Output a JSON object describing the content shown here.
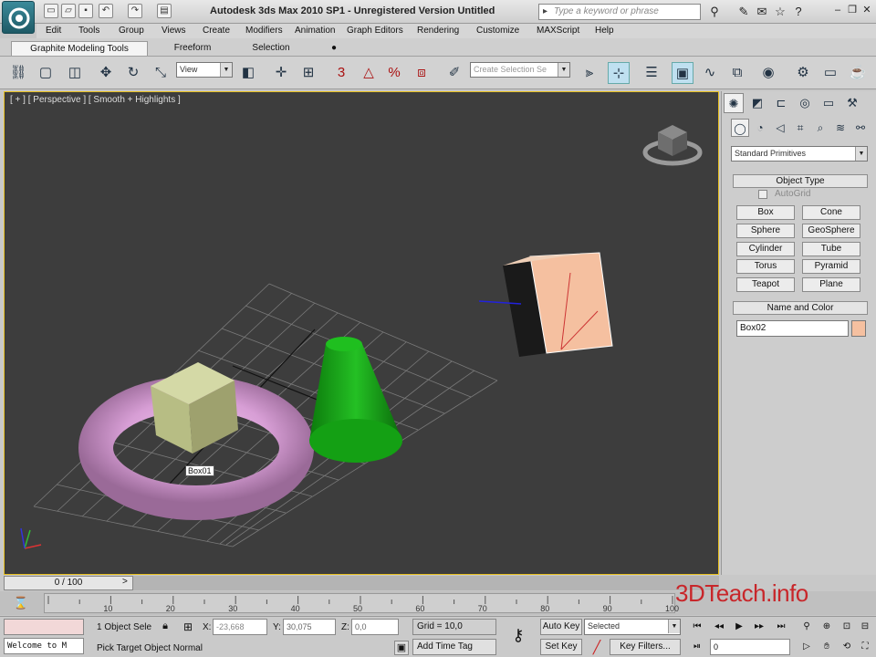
{
  "title_bar": {
    "title": "Autodesk 3ds Max  2010 SP1   -  Unregistered Version     Untitled",
    "search_placeholder": "Type a keyword or phrase"
  },
  "menu_items": [
    "Edit",
    "Tools",
    "Group",
    "Views",
    "Create",
    "Modifiers",
    "Animation",
    "Graph Editors",
    "Rendering",
    "Customize",
    "MAXScript",
    "Help"
  ],
  "ribbon_tabs": [
    "Graphite Modeling Tools",
    "Freeform",
    "Selection"
  ],
  "toolbar": {
    "ref_coord_dropdown": "View",
    "snap_angle_label": "3",
    "percent_snap_label": "%",
    "named_selection_placeholder": "Create Selection Se"
  },
  "viewport": {
    "label": "[ + ] [ Perspective ] [ Smooth + Highlights ]",
    "object_tooltip": "Box01"
  },
  "command_panel": {
    "category_dropdown": "Standard Primitives",
    "object_type_header": "Object Type",
    "autogrid_label": "AutoGrid",
    "buttons": [
      "Box",
      "Cone",
      "Sphere",
      "GeoSphere",
      "Cylinder",
      "Tube",
      "Torus",
      "Pyramid",
      "Teapot",
      "Plane"
    ],
    "name_color_header": "Name and Color",
    "name_value": "Box02",
    "object_color": "#f5c0a0"
  },
  "time_slider": {
    "position_label": "0 / 100",
    "ticks": [
      "10",
      "20",
      "30",
      "40",
      "50",
      "60",
      "70",
      "80",
      "90",
      "100"
    ]
  },
  "status_bar": {
    "listener_text": "Welcome to M",
    "selection_text": "1 Object Sele",
    "prompt_text": "Pick Target Object Normal",
    "x_label": "X:",
    "x_value": "-23,668",
    "y_label": "Y:",
    "y_value": "30,075",
    "z_label": "Z:",
    "z_value": "0,0",
    "grid_text": "Grid = 10,0",
    "add_time_tag": "Add Time Tag",
    "auto_key": "Auto Key",
    "set_key": "Set Key",
    "key_mode_dropdown": "Selected",
    "key_filters": "Key Filters...",
    "frame_value": "0"
  },
  "watermark": "3DTeach.info"
}
